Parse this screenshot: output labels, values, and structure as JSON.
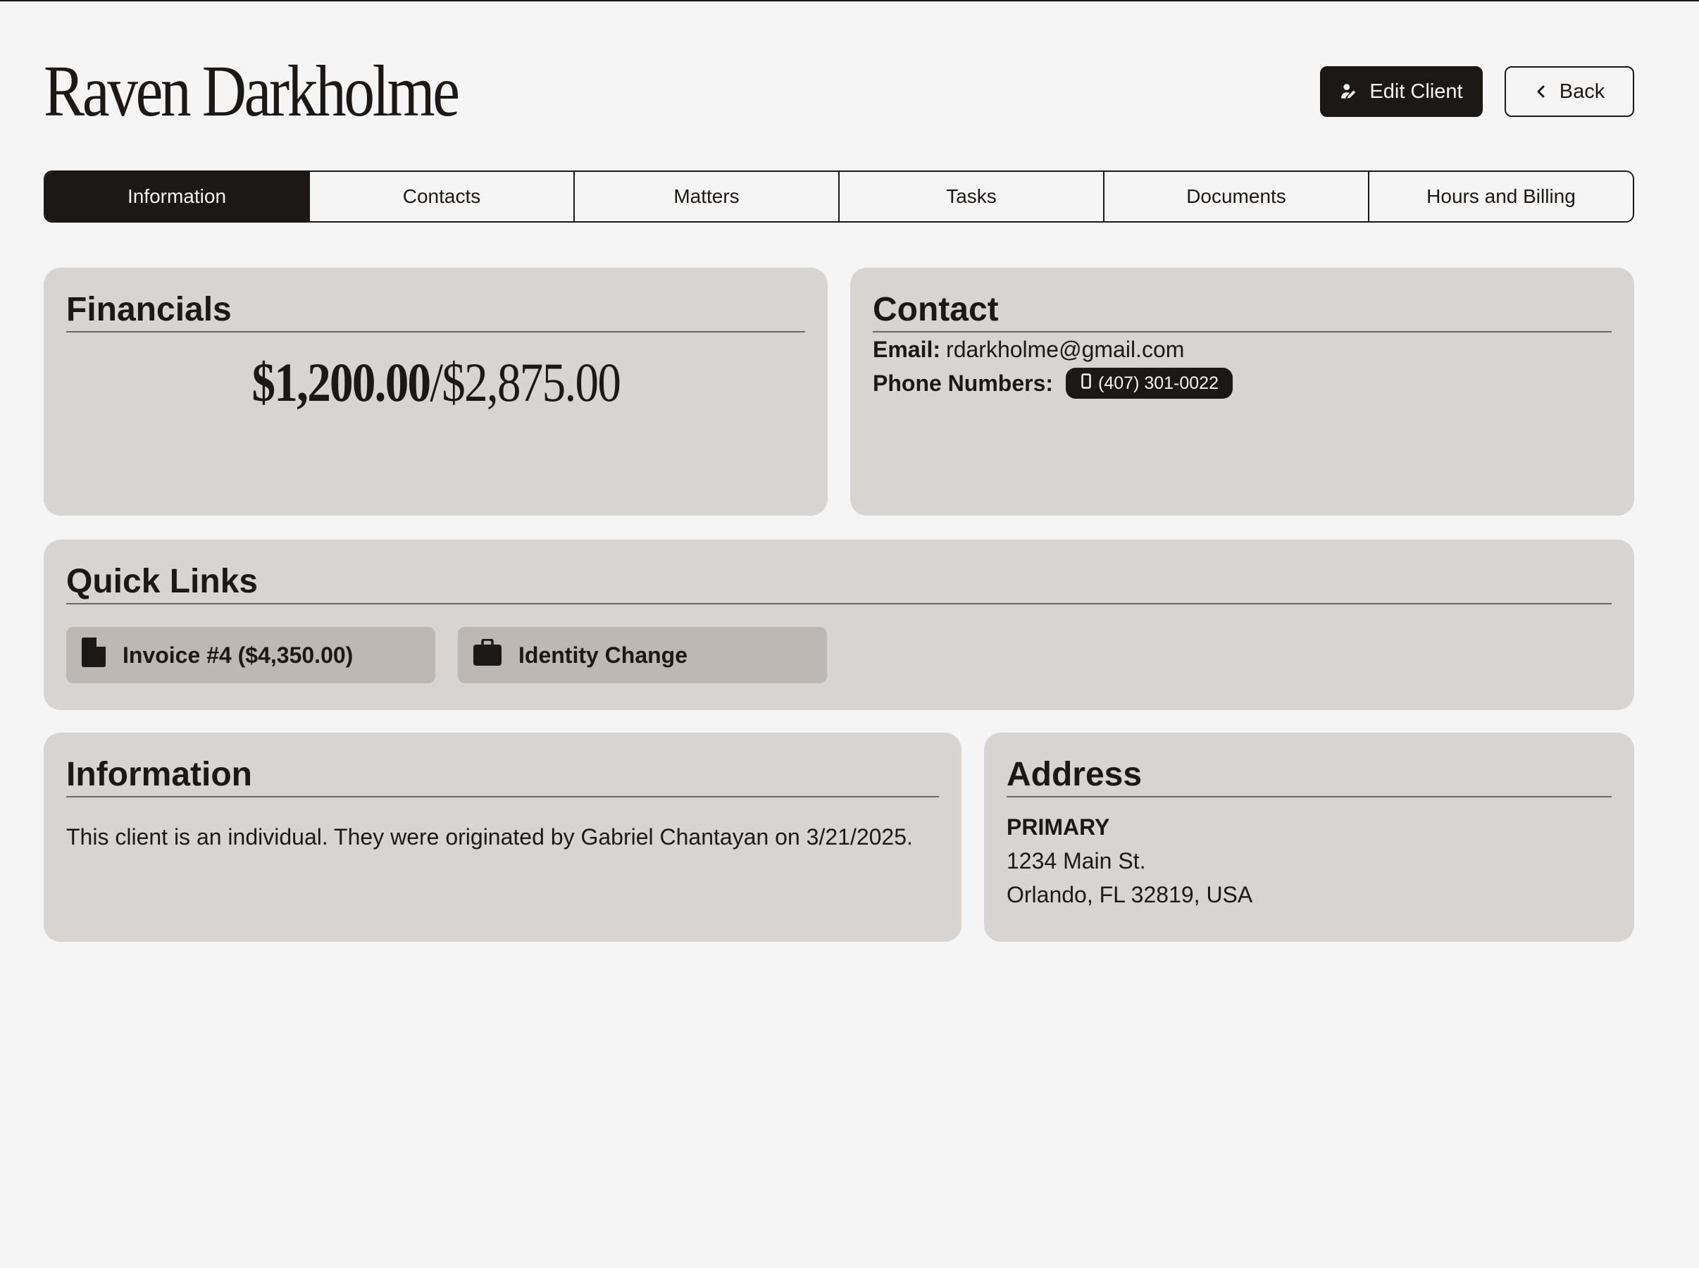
{
  "header": {
    "client_name": "Raven Darkholme",
    "edit_label": "Edit Client",
    "back_label": "Back"
  },
  "tabs": [
    {
      "label": "Information",
      "active": true
    },
    {
      "label": "Contacts"
    },
    {
      "label": "Matters"
    },
    {
      "label": "Tasks"
    },
    {
      "label": "Documents"
    },
    {
      "label": "Hours and Billing"
    }
  ],
  "financials": {
    "title": "Financials",
    "paid": "$1,200.00",
    "separator": "/",
    "total": "$2,875.00"
  },
  "contact": {
    "title": "Contact",
    "email_label": "Email:",
    "email": "rdarkholme@gmail.com",
    "phone_label": "Phone Numbers:",
    "phone": "(407) 301-0022"
  },
  "quick_links": {
    "title": "Quick Links",
    "items": [
      {
        "label": "Invoice #4 ($4,350.00)",
        "icon": "file-icon"
      },
      {
        "label": "Identity Change",
        "icon": "briefcase-icon"
      }
    ]
  },
  "information": {
    "title": "Information",
    "text": "This client is an individual. They were originated by Gabriel Chantayan on 3/21/2025."
  },
  "address": {
    "title": "Address",
    "type": "PRIMARY",
    "line1": "1234 Main St.",
    "line2": "Orlando, FL 32819, USA"
  },
  "colors": {
    "dark": "#1c1816",
    "background": "#f5f5f5",
    "card": "#d8d4d1",
    "chip": "#bdb8b4"
  }
}
